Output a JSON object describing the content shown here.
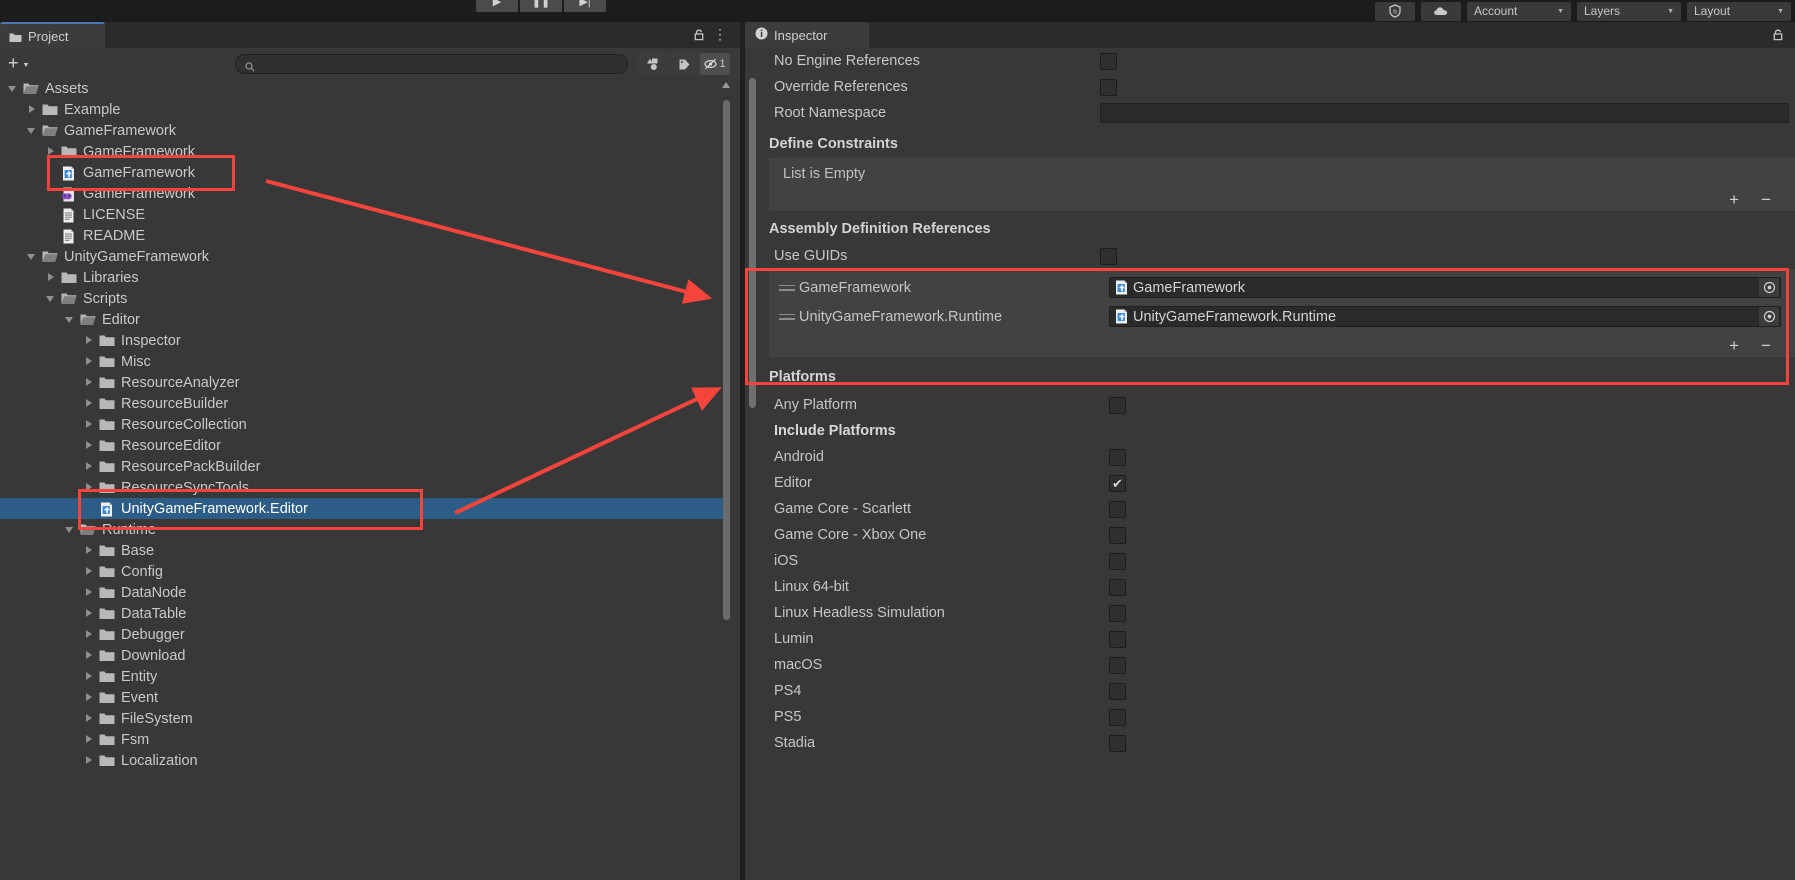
{
  "toolbar": {
    "play_label": "▶",
    "pause_label": "❚❚",
    "step_label": "▶|",
    "cloud_icon": "cloud-icon",
    "collab_icon": "collab-icon",
    "account_label": "Account",
    "layers_label": "Layers",
    "layout_label": "Layout"
  },
  "project": {
    "tab_label": "Project",
    "add_label": "+",
    "search_placeholder": "",
    "search_value": "",
    "filter_count": "1",
    "tree": [
      {
        "label": "Assets",
        "depth": 0,
        "arrow": "open",
        "icon": "folder-open",
        "selected": false
      },
      {
        "label": "Example",
        "depth": 1,
        "arrow": "closed",
        "icon": "folder",
        "selected": false
      },
      {
        "label": "GameFramework",
        "depth": 1,
        "arrow": "open",
        "icon": "folder-open",
        "selected": false
      },
      {
        "label": "GameFramework",
        "depth": 2,
        "arrow": "closed",
        "icon": "folder",
        "selected": false
      },
      {
        "label": "GameFramework",
        "depth": 2,
        "arrow": "none",
        "icon": "asmdef",
        "selected": false
      },
      {
        "label": "GameFramework",
        "depth": 2,
        "arrow": "none",
        "icon": "dll",
        "selected": false
      },
      {
        "label": "LICENSE",
        "depth": 2,
        "arrow": "none",
        "icon": "textfile",
        "selected": false
      },
      {
        "label": "README",
        "depth": 2,
        "arrow": "none",
        "icon": "textfile",
        "selected": false
      },
      {
        "label": "UnityGameFramework",
        "depth": 1,
        "arrow": "open",
        "icon": "folder-open",
        "selected": false
      },
      {
        "label": "Libraries",
        "depth": 2,
        "arrow": "closed",
        "icon": "folder",
        "selected": false
      },
      {
        "label": "Scripts",
        "depth": 2,
        "arrow": "open",
        "icon": "folder-open",
        "selected": false
      },
      {
        "label": "Editor",
        "depth": 3,
        "arrow": "open",
        "icon": "folder-open",
        "selected": false
      },
      {
        "label": "Inspector",
        "depth": 4,
        "arrow": "closed",
        "icon": "folder",
        "selected": false
      },
      {
        "label": "Misc",
        "depth": 4,
        "arrow": "closed",
        "icon": "folder",
        "selected": false
      },
      {
        "label": "ResourceAnalyzer",
        "depth": 4,
        "arrow": "closed",
        "icon": "folder",
        "selected": false
      },
      {
        "label": "ResourceBuilder",
        "depth": 4,
        "arrow": "closed",
        "icon": "folder",
        "selected": false
      },
      {
        "label": "ResourceCollection",
        "depth": 4,
        "arrow": "closed",
        "icon": "folder",
        "selected": false
      },
      {
        "label": "ResourceEditor",
        "depth": 4,
        "arrow": "closed",
        "icon": "folder",
        "selected": false
      },
      {
        "label": "ResourcePackBuilder",
        "depth": 4,
        "arrow": "closed",
        "icon": "folder",
        "selected": false
      },
      {
        "label": "ResourceSyncTools",
        "depth": 4,
        "arrow": "closed",
        "icon": "folder",
        "selected": false
      },
      {
        "label": "UnityGameFramework.Editor",
        "depth": 4,
        "arrow": "none",
        "icon": "asmdef",
        "selected": true
      },
      {
        "label": "Runtime",
        "depth": 3,
        "arrow": "open",
        "icon": "folder-open",
        "selected": false
      },
      {
        "label": "Base",
        "depth": 4,
        "arrow": "closed",
        "icon": "folder",
        "selected": false
      },
      {
        "label": "Config",
        "depth": 4,
        "arrow": "closed",
        "icon": "folder",
        "selected": false
      },
      {
        "label": "DataNode",
        "depth": 4,
        "arrow": "closed",
        "icon": "folder",
        "selected": false
      },
      {
        "label": "DataTable",
        "depth": 4,
        "arrow": "closed",
        "icon": "folder",
        "selected": false
      },
      {
        "label": "Debugger",
        "depth": 4,
        "arrow": "closed",
        "icon": "folder",
        "selected": false
      },
      {
        "label": "Download",
        "depth": 4,
        "arrow": "closed",
        "icon": "folder",
        "selected": false
      },
      {
        "label": "Entity",
        "depth": 4,
        "arrow": "closed",
        "icon": "folder",
        "selected": false
      },
      {
        "label": "Event",
        "depth": 4,
        "arrow": "closed",
        "icon": "folder",
        "selected": false
      },
      {
        "label": "FileSystem",
        "depth": 4,
        "arrow": "closed",
        "icon": "folder",
        "selected": false
      },
      {
        "label": "Fsm",
        "depth": 4,
        "arrow": "closed",
        "icon": "folder",
        "selected": false
      },
      {
        "label": "Localization",
        "depth": 4,
        "arrow": "closed",
        "icon": "folder",
        "selected": false
      }
    ]
  },
  "inspector": {
    "tab_label": "Inspector",
    "props": [
      {
        "label": "No Engine References",
        "type": "checkbox",
        "checked": false
      },
      {
        "label": "Override References",
        "type": "checkbox",
        "checked": false
      },
      {
        "label": "Root Namespace",
        "type": "text",
        "value": ""
      }
    ],
    "define_constraints": {
      "title": "Define Constraints",
      "empty_text": "List is Empty",
      "add_label": "+",
      "remove_label": "−"
    },
    "assembly_refs": {
      "title": "Assembly Definition References",
      "use_guids_label": "Use GUIDs",
      "use_guids_checked": false,
      "rows": [
        {
          "name": "GameFramework",
          "object": "GameFramework"
        },
        {
          "name": "UnityGameFramework.Runtime",
          "object": "UnityGameFramework.Runtime"
        }
      ],
      "add_label": "+",
      "remove_label": "−"
    },
    "platforms": {
      "title": "Platforms",
      "rows": [
        {
          "label": "Any Platform",
          "bold": false,
          "checked": false,
          "has_checkbox": true
        },
        {
          "label": "Include Platforms",
          "bold": true,
          "checked": false,
          "has_checkbox": false
        },
        {
          "label": "Android",
          "bold": false,
          "checked": false,
          "has_checkbox": true
        },
        {
          "label": "Editor",
          "bold": false,
          "checked": true,
          "has_checkbox": true
        },
        {
          "label": "Game Core - Scarlett",
          "bold": false,
          "checked": false,
          "has_checkbox": true
        },
        {
          "label": "Game Core - Xbox One",
          "bold": false,
          "checked": false,
          "has_checkbox": true
        },
        {
          "label": "iOS",
          "bold": false,
          "checked": false,
          "has_checkbox": true
        },
        {
          "label": "Linux 64-bit",
          "bold": false,
          "checked": false,
          "has_checkbox": true
        },
        {
          "label": "Linux Headless Simulation",
          "bold": false,
          "checked": false,
          "has_checkbox": true
        },
        {
          "label": "Lumin",
          "bold": false,
          "checked": false,
          "has_checkbox": true
        },
        {
          "label": "macOS",
          "bold": false,
          "checked": false,
          "has_checkbox": true
        },
        {
          "label": "PS4",
          "bold": false,
          "checked": false,
          "has_checkbox": true
        },
        {
          "label": "PS5",
          "bold": false,
          "checked": false,
          "has_checkbox": true
        },
        {
          "label": "Stadia",
          "bold": false,
          "checked": false,
          "has_checkbox": true
        }
      ]
    }
  },
  "annotations": {
    "highlight_color": "#f4443c",
    "boxes": [
      {
        "name": "gameframework-asmdef-highlight"
      },
      {
        "name": "unitygameframework-editor-highlight"
      },
      {
        "name": "assembly-references-highlight"
      }
    ],
    "arrows": [
      {
        "name": "arrow-to-assembly-references"
      },
      {
        "name": "arrow-to-selected-asmdef"
      }
    ]
  },
  "check_glyph": "✔"
}
